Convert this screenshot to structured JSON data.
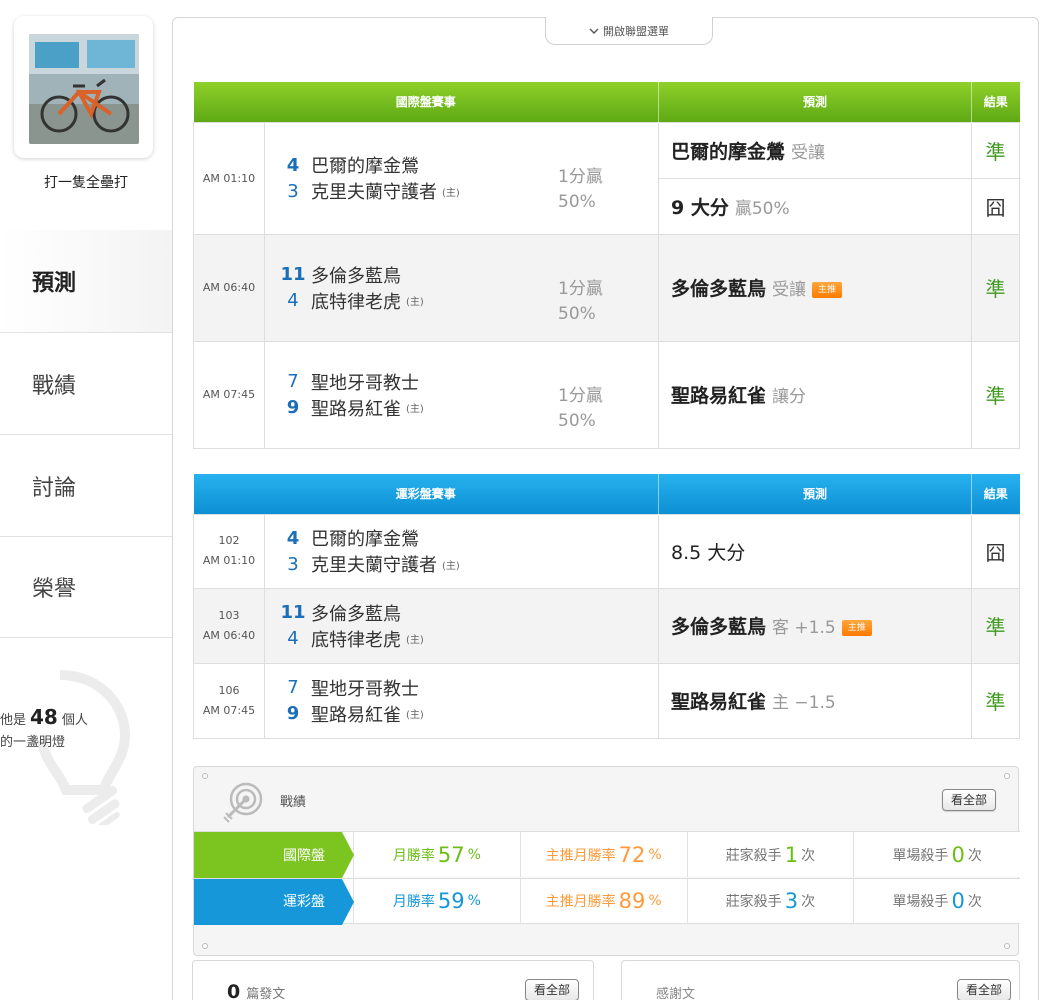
{
  "user": {
    "name": "打一隻全壘打"
  },
  "nav": {
    "items": [
      {
        "label": "預測",
        "active": true
      },
      {
        "label": "戰績",
        "active": false
      },
      {
        "label": "討論",
        "active": false
      },
      {
        "label": "榮譽",
        "active": false
      }
    ]
  },
  "bulb": {
    "prefix": "他是",
    "count": "48",
    "suffix": "個人",
    "line2": "的一盞明燈"
  },
  "league_menu": {
    "label": "開啟聯盟選單",
    "icon": "chevron-down-icon"
  },
  "intl_table": {
    "headers": [
      "國際盤賽事",
      "預測",
      "結果"
    ],
    "rows": [
      {
        "time": "AM 01:10",
        "away_score": "4",
        "away_team": "巴爾的摩金鶯",
        "home_score": "3",
        "home_team": "克里夫蘭守護者",
        "home_mark": "(主)",
        "handicap_line1": "1分贏",
        "handicap_line2": "50%",
        "pred1_main": "巴爾的摩金鶯",
        "pred1_sub": "受讓",
        "result1": "準",
        "pred2_main": "9 大分",
        "pred2_sub": "贏50%",
        "result2": "囧"
      },
      {
        "time": "AM 06:40",
        "away_score": "11",
        "away_team": "多倫多藍鳥",
        "home_score": "4",
        "home_team": "底特律老虎",
        "home_mark": "(主)",
        "handicap_line1": "1分贏",
        "handicap_line2": "50%",
        "pred_main": "多倫多藍鳥",
        "pred_sub": "受讓",
        "badge": "主推",
        "result": "準"
      },
      {
        "time": "AM 07:45",
        "away_score": "7",
        "away_team": "聖地牙哥教士",
        "home_score": "9",
        "home_team": "聖路易紅雀",
        "home_mark": "(主)",
        "handicap_line1": "1分贏",
        "handicap_line2": "50%",
        "pred_main": "聖路易紅雀",
        "pred_sub": "讓分",
        "result": "準"
      }
    ]
  },
  "sports_table": {
    "headers": [
      "運彩盤賽事",
      "預測",
      "結果"
    ],
    "rows": [
      {
        "num": "102",
        "time": "AM 01:10",
        "away_score": "4",
        "away_team": "巴爾的摩金鶯",
        "home_score": "3",
        "home_team": "克里夫蘭守護者",
        "home_mark": "(主)",
        "pred_main": "8.5 大分",
        "pred_sub": "",
        "result": "囧"
      },
      {
        "num": "103",
        "time": "AM 06:40",
        "away_score": "11",
        "away_team": "多倫多藍鳥",
        "home_score": "4",
        "home_team": "底特律老虎",
        "home_mark": "(主)",
        "pred_main": "多倫多藍鳥",
        "pred_sub": "客 +1.5",
        "badge": "主推",
        "result": "準"
      },
      {
        "num": "106",
        "time": "AM 07:45",
        "away_score": "7",
        "away_team": "聖地牙哥教士",
        "home_score": "9",
        "home_team": "聖路易紅雀",
        "home_mark": "(主)",
        "pred_main": "聖路易紅雀",
        "pred_sub": "主 −1.5",
        "result": "準"
      }
    ]
  },
  "stats": {
    "title": "戰績",
    "view_all": "看全部",
    "rows": [
      {
        "label": "國際盤",
        "color": "#7cc520",
        "monthly_label": "月勝率",
        "monthly": "57",
        "pct": "%",
        "featured_label": "主推月勝率",
        "featured": "72",
        "pct2": "%",
        "dealer_label": "莊家殺手",
        "dealer": "1",
        "unit": "次",
        "single_label": "單場殺手",
        "single": "0",
        "unit2": "次"
      },
      {
        "label": "運彩盤",
        "color": "#1597da",
        "monthly_label": "月勝率",
        "monthly": "59",
        "pct": "%",
        "featured_label": "主推月勝率",
        "featured": "89",
        "pct2": "%",
        "dealer_label": "莊家殺手",
        "dealer": "3",
        "unit": "次",
        "single_label": "單場殺手",
        "single": "0",
        "unit2": "次"
      }
    ]
  },
  "posts": {
    "count": "0",
    "label": "篇發文",
    "view_all": "看全部"
  },
  "thanks": {
    "label": "感謝文",
    "view_all": "看全部"
  }
}
